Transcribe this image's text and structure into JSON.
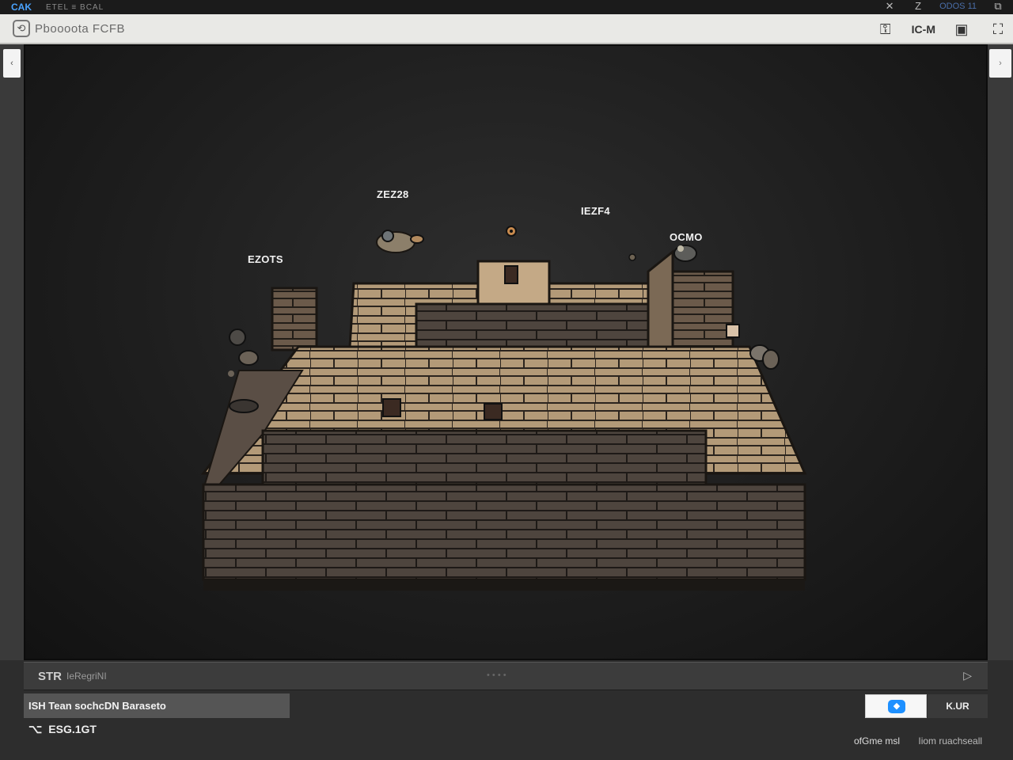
{
  "topbar": {
    "brand": "CAK",
    "menu": "ETEL ≡ BCAL",
    "stat": "ODOS 11"
  },
  "toolbar": {
    "title": "Pboooota FCFB",
    "tools_label": "IC-M"
  },
  "scene": {
    "labels": [
      "ZEZ28",
      "IEZF4",
      "EZOTS",
      "OCMO"
    ]
  },
  "bottom": {
    "status_title": "STR",
    "status_sub": "IeRegriNI",
    "status_mid": "• • • •",
    "selected_row": "ISH Tean sochcDN Baraseto",
    "blue_button": "◆",
    "gray_button": "K.UR",
    "small_row": "ESG.1GT",
    "footer_left": "ofGme msl",
    "footer_right": "Iiom ruachseall"
  }
}
